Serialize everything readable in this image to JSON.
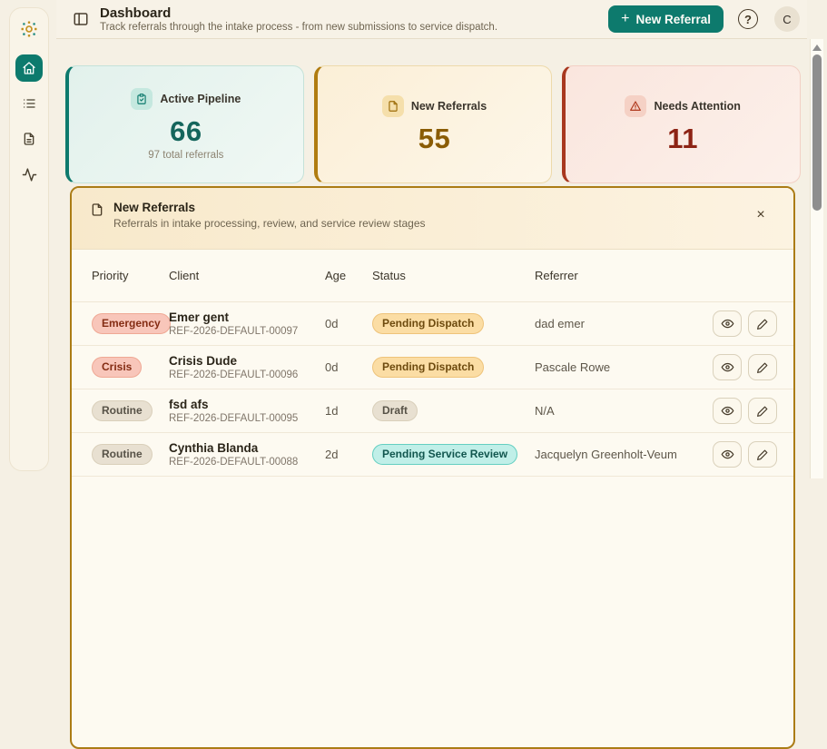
{
  "header": {
    "title": "Dashboard",
    "subtitle": "Track referrals through the intake process - from new submissions to service dispatch.",
    "new_referral_label": "New Referral",
    "plus": "+",
    "help_label": "?",
    "avatar_initial": "C"
  },
  "sidebar": {
    "items": [
      {
        "icon": "home-icon",
        "active": true
      },
      {
        "icon": "list-icon",
        "active": false
      },
      {
        "icon": "document-icon",
        "active": false
      },
      {
        "icon": "activity-icon",
        "active": false
      }
    ]
  },
  "stats": [
    {
      "icon": "clipboard-check-icon",
      "label": "Active Pipeline",
      "value": "66",
      "sub": "97 total referrals",
      "accent": "#0d7a6d"
    },
    {
      "icon": "file-icon",
      "label": "New Referrals",
      "value": "55",
      "sub": "",
      "accent": "#b07c10"
    },
    {
      "icon": "alert-triangle-icon",
      "label": "Needs Attention",
      "value": "11",
      "sub": "",
      "accent": "#a8381f"
    }
  ],
  "panel": {
    "icon": "file-icon",
    "title": "New Referrals",
    "subtitle": "Referrals in intake processing, review, and service review stages",
    "close": "×"
  },
  "table": {
    "columns": [
      "Priority",
      "Client",
      "Age",
      "Status",
      "Referrer"
    ],
    "rows": [
      {
        "priority": "Emergency",
        "priority_variant": "emergency",
        "client": "Emer gent",
        "ref": "REF-2026-DEFAULT-00097",
        "age": "0d",
        "status": "Pending Dispatch",
        "status_variant": "pending-dispatch",
        "referrer": "dad emer"
      },
      {
        "priority": "Crisis",
        "priority_variant": "crisis",
        "client": "Crisis Dude",
        "ref": "REF-2026-DEFAULT-00096",
        "age": "0d",
        "status": "Pending Dispatch",
        "status_variant": "pending-dispatch",
        "referrer": "Pascale Rowe"
      },
      {
        "priority": "Routine",
        "priority_variant": "routine",
        "client": "fsd afs",
        "ref": "REF-2026-DEFAULT-00095",
        "age": "1d",
        "status": "Draft",
        "status_variant": "draft",
        "referrer": "N/A"
      },
      {
        "priority": "Routine",
        "priority_variant": "routine",
        "client": "Cynthia Blanda",
        "ref": "REF-2026-DEFAULT-00088",
        "age": "2d",
        "status": "Pending Service Review",
        "status_variant": "pending-service-review",
        "referrer": "Jacquelyn Greenholt-Veum"
      }
    ]
  },
  "colors": {
    "accent_teal": "#0d7a6d",
    "accent_amber": "#b07c10",
    "accent_red": "#a8381f",
    "page_bg": "#f5f0e4",
    "panel_border": "#ab7c15"
  }
}
